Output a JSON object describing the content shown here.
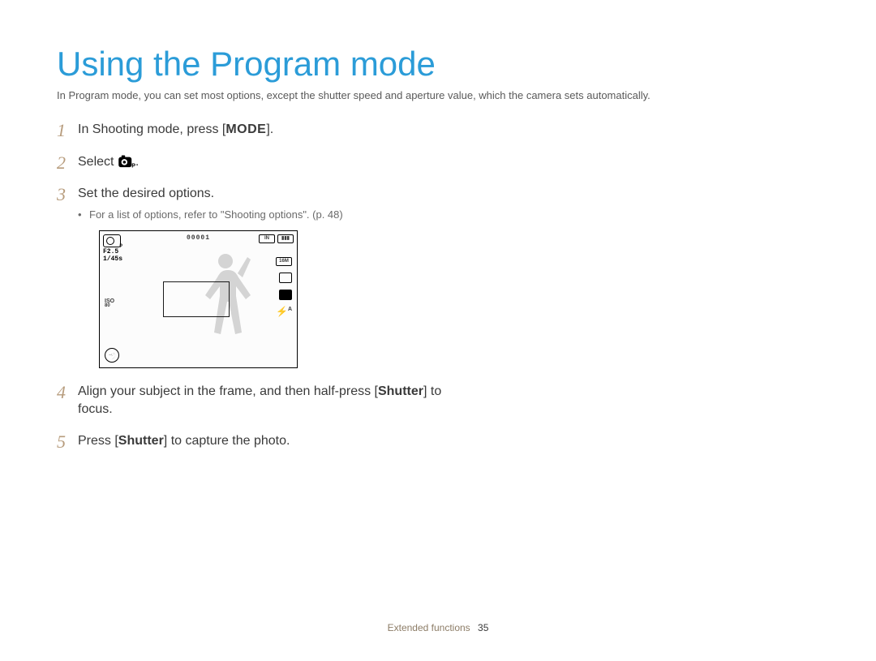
{
  "title": "Using the Program mode",
  "intro": "In Program mode, you can set most options, except the shutter speed and aperture value, which the camera sets automatically.",
  "steps": {
    "s1": {
      "num": "1",
      "pre": "In Shooting mode, press [",
      "mode": "MODE",
      "post": "]."
    },
    "s2": {
      "num": "2",
      "pre": "Select ",
      "post": "."
    },
    "s3": {
      "num": "3",
      "text": "Set the desired options.",
      "bullet": "For a list of options, refer to \"Shooting options\". (p. 48)"
    },
    "s4": {
      "num": "4",
      "pre": "Align your subject in the frame, and then half-press [",
      "bold": "Shutter",
      "post": "] to focus."
    },
    "s5": {
      "num": "5",
      "pre": "Press [",
      "bold": "Shutter",
      "post": "] to capture the photo."
    }
  },
  "lcd": {
    "aperture": "F2.5",
    "shutter": "1/45s",
    "counter": "00001",
    "storage": "IN",
    "battery": "full",
    "size_label": "16M",
    "iso_label_top": "ISO",
    "iso_label_bottom": "80",
    "flash_label": "A"
  },
  "footer": {
    "section": "Extended functions",
    "page": "35"
  }
}
